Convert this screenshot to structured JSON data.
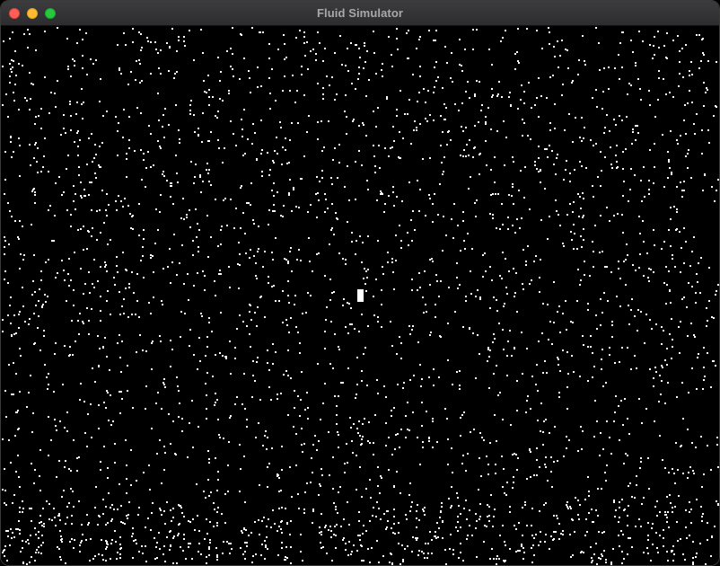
{
  "window": {
    "title": "Fluid Simulator"
  },
  "colors": {
    "background": "#000000",
    "particle": "#ffffff",
    "close": "#ff5f57",
    "minimize": "#febc2e",
    "maximize": "#28c840"
  },
  "icons": {
    "close": "close-traffic-light-icon",
    "minimize": "minimize-traffic-light-icon",
    "maximize": "maximize-traffic-light-icon"
  }
}
